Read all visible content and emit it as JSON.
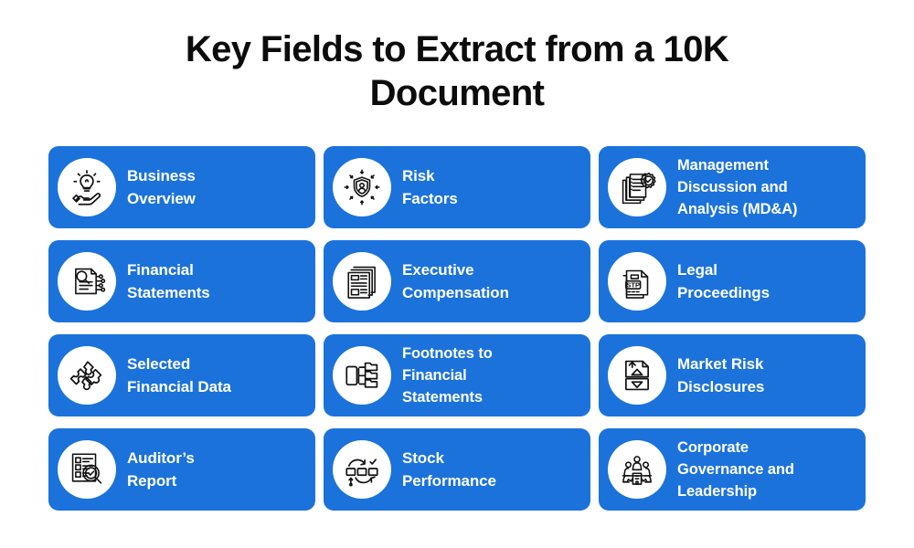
{
  "title": "Key Fields to Extract from a 10K Document",
  "colors": {
    "card_background": "#1b72db",
    "card_text": "#ffffff",
    "icon_circle": "#ffffff",
    "icon_stroke": "#111111",
    "page_background": "#ffffff",
    "title_text": "#0c0c0c"
  },
  "cards": [
    {
      "label": "Business\nOverview",
      "icon": "hand-lightbulb-icon"
    },
    {
      "label": "Risk\nFactors",
      "icon": "shield-person-arrows-icon"
    },
    {
      "label": "Management\nDiscussion and\nAnalysis (MD&A)",
      "icon": "documents-gear-check-icon"
    },
    {
      "label": "Financial\nStatements",
      "icon": "document-magnifier-circuit-icon"
    },
    {
      "label": "Executive\nCompensation",
      "icon": "stacked-newspapers-icon"
    },
    {
      "label": "Legal\nProceedings",
      "icon": "document-stamp-stp-icon"
    },
    {
      "label": "Selected\nFinancial Data",
      "icon": "puzzle-pieces-icon"
    },
    {
      "label": "Footnotes to\nFinancial\nStatements",
      "icon": "document-tree-branch-icon"
    },
    {
      "label": "Market Risk\nDisclosures",
      "icon": "document-up-down-arrows-icon"
    },
    {
      "label": "Auditor’s\nReport",
      "icon": "checklist-magnifier-check-icon"
    },
    {
      "label": "Stock\nPerformance",
      "icon": "boxes-cycle-arrows-check-icon"
    },
    {
      "label": "Corporate\nGovernance and\nLeadership",
      "icon": "people-gear-building-icon"
    }
  ],
  "icon_stamp_text": "STP"
}
